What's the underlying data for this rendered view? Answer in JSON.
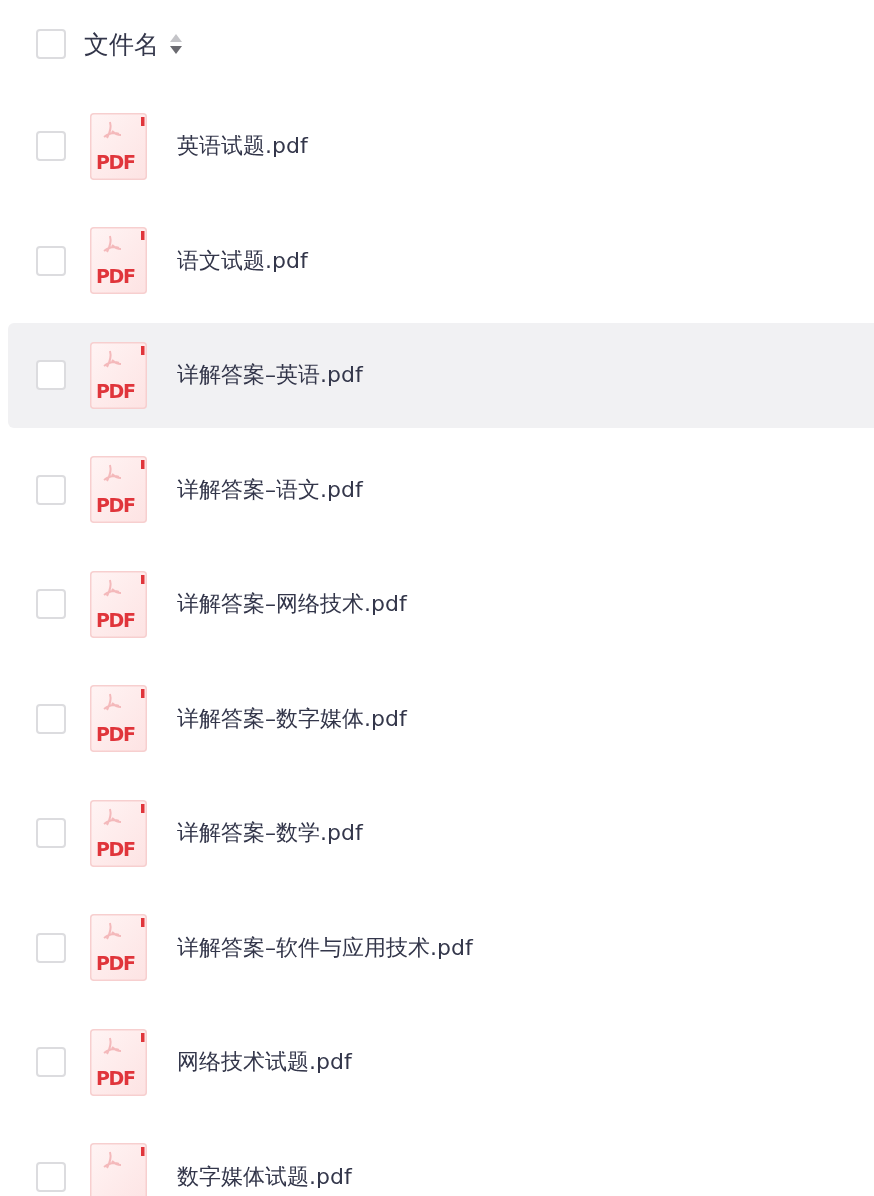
{
  "header": {
    "checked": false,
    "label": "文件名"
  },
  "files": [
    {
      "name": "英语试题.pdf",
      "icon_text": "PDF",
      "checked": false,
      "highlighted": false
    },
    {
      "name": "语文试题.pdf",
      "icon_text": "PDF",
      "checked": false,
      "highlighted": false
    },
    {
      "name": "详解答案–英语.pdf",
      "icon_text": "PDF",
      "checked": false,
      "highlighted": true
    },
    {
      "name": "详解答案–语文.pdf",
      "icon_text": "PDF",
      "checked": false,
      "highlighted": false
    },
    {
      "name": "详解答案–网络技术.pdf",
      "icon_text": "PDF",
      "checked": false,
      "highlighted": false
    },
    {
      "name": "详解答案–数字媒体.pdf",
      "icon_text": "PDF",
      "checked": false,
      "highlighted": false
    },
    {
      "name": "详解答案–数学.pdf",
      "icon_text": "PDF",
      "checked": false,
      "highlighted": false
    },
    {
      "name": "详解答案–软件与应用技术.pdf",
      "icon_text": "PDF",
      "checked": false,
      "highlighted": false
    },
    {
      "name": "网络技术试题.pdf",
      "icon_text": "PDF",
      "checked": false,
      "highlighted": false
    },
    {
      "name": "数字媒体试题.pdf",
      "checked": false,
      "highlighted": false
    }
  ]
}
